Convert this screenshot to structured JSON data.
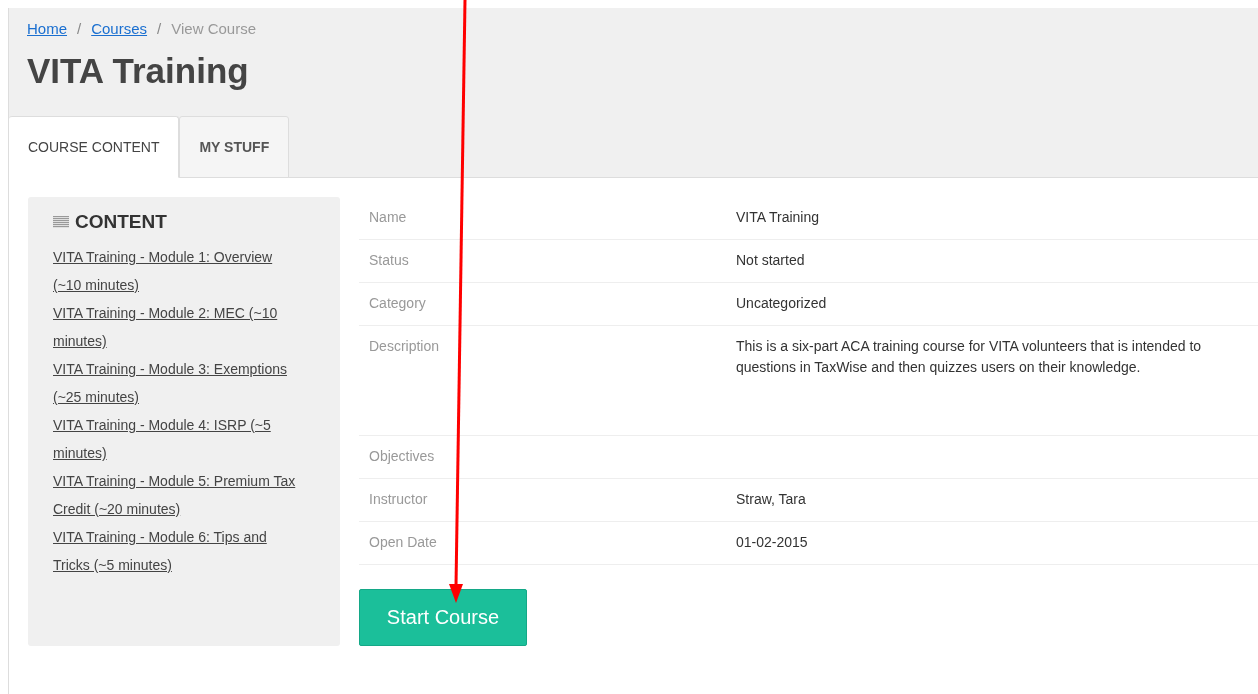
{
  "breadcrumb": [
    {
      "label": "Home",
      "link": true
    },
    {
      "label": "Courses",
      "link": true
    },
    {
      "label": "View Course",
      "link": false
    }
  ],
  "separator": "/",
  "title": "VITA Training",
  "tabs": [
    {
      "label": "COURSE CONTENT",
      "selected": true
    },
    {
      "label": "MY STUFF",
      "selected": false
    }
  ],
  "content": {
    "heading": "CONTENT",
    "items": [
      "VITA Training - Module 1: Overview (~10 minutes)",
      "VITA Training - Module 2: MEC (~10 minutes)",
      "VITA Training - Module 3: Exemptions (~25 minutes)",
      "VITA Training - Module 4: ISRP (~5 minutes)",
      "VITA Training - Module 5: Premium Tax Credit (~20 minutes)",
      "VITA Training - Module 6: Tips and Tricks (~5 minutes)"
    ]
  },
  "details": [
    {
      "label": "Name",
      "value": [
        "VITA Training"
      ]
    },
    {
      "label": "Status",
      "value": [
        "Not started"
      ]
    },
    {
      "label": "Category",
      "value": [
        "Uncategorized"
      ]
    },
    {
      "label": "Description",
      "value": [
        "This is a six-part ACA training course for VITA volunteers that is intended to",
        "questions in TaxWise and then quizzes users on their knowledge."
      ]
    },
    {
      "label": "Objectives"
    },
    {
      "label": "Instructor",
      "value": [
        "Straw, Tara"
      ]
    },
    {
      "label": "Open Date",
      "value": [
        "01-02-2015"
      ]
    }
  ],
  "start_button": "Start Course"
}
